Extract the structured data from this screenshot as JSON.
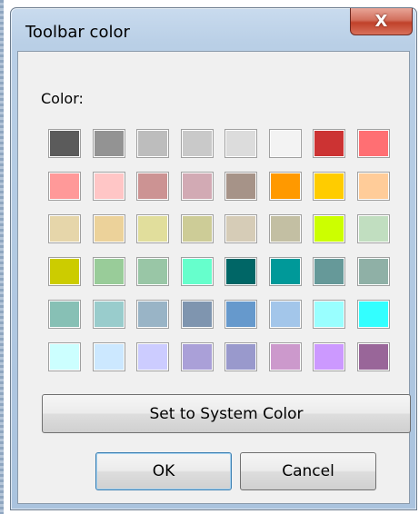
{
  "window": {
    "title": "Toolbar color",
    "close_glyph": "X",
    "close_icon": "close-icon"
  },
  "color_label": "Color:",
  "swatches": [
    [
      "#5b5b5b",
      "#939393",
      "#bdbdbd",
      "#c9c9c9",
      "#dcdcdc",
      "#f3f3f3",
      "#cc3333",
      "#ff6f73"
    ],
    [
      "#ff9999",
      "#ffc6c6",
      "#cc9393",
      "#d2aab4",
      "#a69388",
      "#ff9900",
      "#ffcc00",
      "#ffcc99"
    ],
    [
      "#e6d6aa",
      "#ecd29a",
      "#e1de9c",
      "#cdcc97",
      "#d6ccb7",
      "#c3bfa3",
      "#ccff00",
      "#c1dec0"
    ],
    [
      "#cccc00",
      "#99cc99",
      "#99c6a6",
      "#66ffcc",
      "#006666",
      "#009999",
      "#669999",
      "#8fb0a6"
    ],
    [
      "#87c0b5",
      "#99cccc",
      "#99b4c6",
      "#7f95af",
      "#6699cc",
      "#a3c6ea",
      "#99ffff",
      "#33ffff"
    ],
    [
      "#ccffff",
      "#cce8ff",
      "#ccccff",
      "#aaa0d8",
      "#9999cc",
      "#cc99cc",
      "#cc99ff",
      "#996699"
    ]
  ],
  "buttons": {
    "system_color": "Set to System Color",
    "ok": "OK",
    "cancel": "Cancel"
  }
}
